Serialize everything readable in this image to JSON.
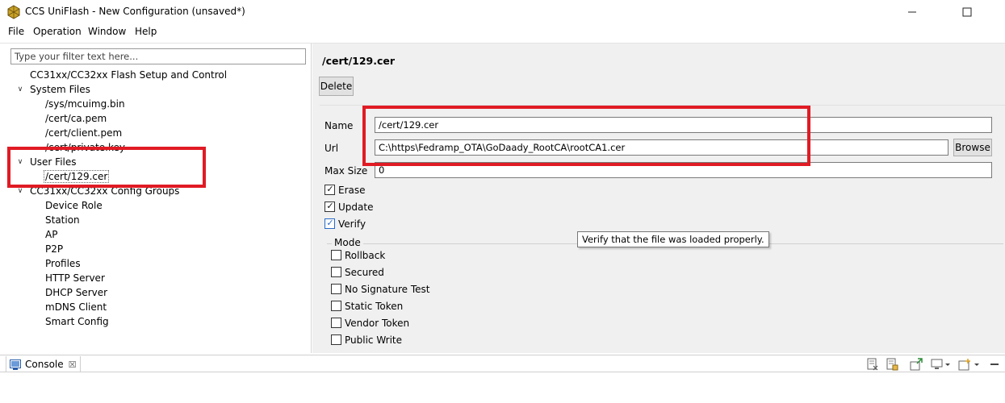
{
  "window": {
    "title": "CCS UniFlash - New Configuration (unsaved*)"
  },
  "menu": [
    "File",
    "Operation",
    "Window",
    "Help"
  ],
  "filter": {
    "placeholder": "Type your filter text here..."
  },
  "tree": {
    "root_label": "CC31xx/CC32xx Flash Setup and Control",
    "system_files": {
      "label": "System Files",
      "items": [
        "/sys/mcuimg.bin",
        "/cert/ca.pem",
        "/cert/client.pem",
        "/cert/private.key"
      ]
    },
    "user_files": {
      "label": "User Files",
      "items": [
        "/cert/129.cer"
      ]
    },
    "config_groups": {
      "label": "CC31xx/CC32xx Config Groups",
      "items": [
        "Device Role",
        "Station",
        "AP",
        "P2P",
        "Profiles",
        "HTTP Server",
        "DHCP Server",
        "mDNS Client",
        "Smart Config"
      ]
    }
  },
  "detail": {
    "title": "/cert/129.cer",
    "delete_label": "Delete",
    "name_label": "Name",
    "name_value": "/cert/129.cer",
    "url_label": "Url",
    "url_value": "C:\\https\\Fedramp_OTA\\GoDaady_RootCA\\rootCA1.cer",
    "browse_label": "Browse",
    "max_size_label": "Max Size",
    "max_size_value": "0",
    "erase_label": "Erase",
    "erase_checked": true,
    "update_label": "Update",
    "update_checked": true,
    "verify_label": "Verify",
    "verify_checked": true,
    "mode_label": "Mode",
    "mode_options": [
      {
        "label": "Rollback",
        "checked": false
      },
      {
        "label": "Secured",
        "checked": false
      },
      {
        "label": "No Signature Test",
        "checked": false
      },
      {
        "label": "Static Token",
        "checked": false
      },
      {
        "label": "Vendor Token",
        "checked": false
      },
      {
        "label": "Public Write",
        "checked": false
      }
    ],
    "tooltip": "Verify that the file was loaded properly."
  },
  "console": {
    "tab_label": "Console"
  },
  "colors": {
    "highlight": "#e01b24",
    "panel_bg": "#f0f0f0",
    "checkbox_focus": "#2a6ac7"
  }
}
